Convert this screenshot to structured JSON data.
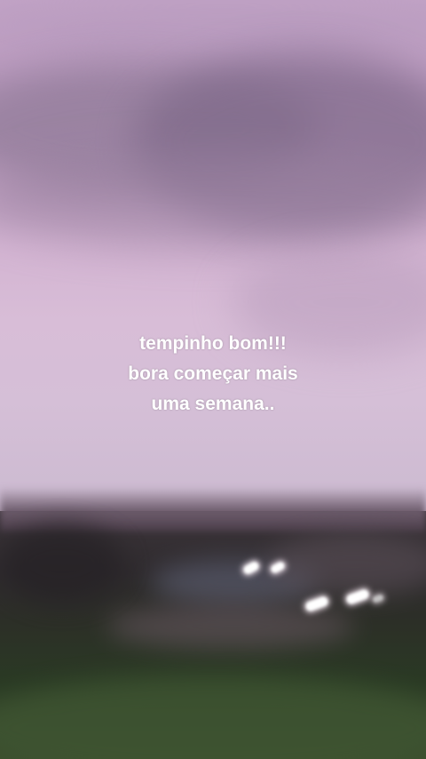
{
  "caption": {
    "lines": [
      "tempinho bom!!!",
      "bora começar mais",
      "uma semana.."
    ]
  },
  "scene": {
    "subject": "purple-evening-sky-over-landscape",
    "colors": {
      "sky": "#c9acc9",
      "clouds": "#7d6888",
      "ground": "#2c2f27",
      "grass": "#3b4e2d",
      "text": "#ffffff"
    }
  }
}
